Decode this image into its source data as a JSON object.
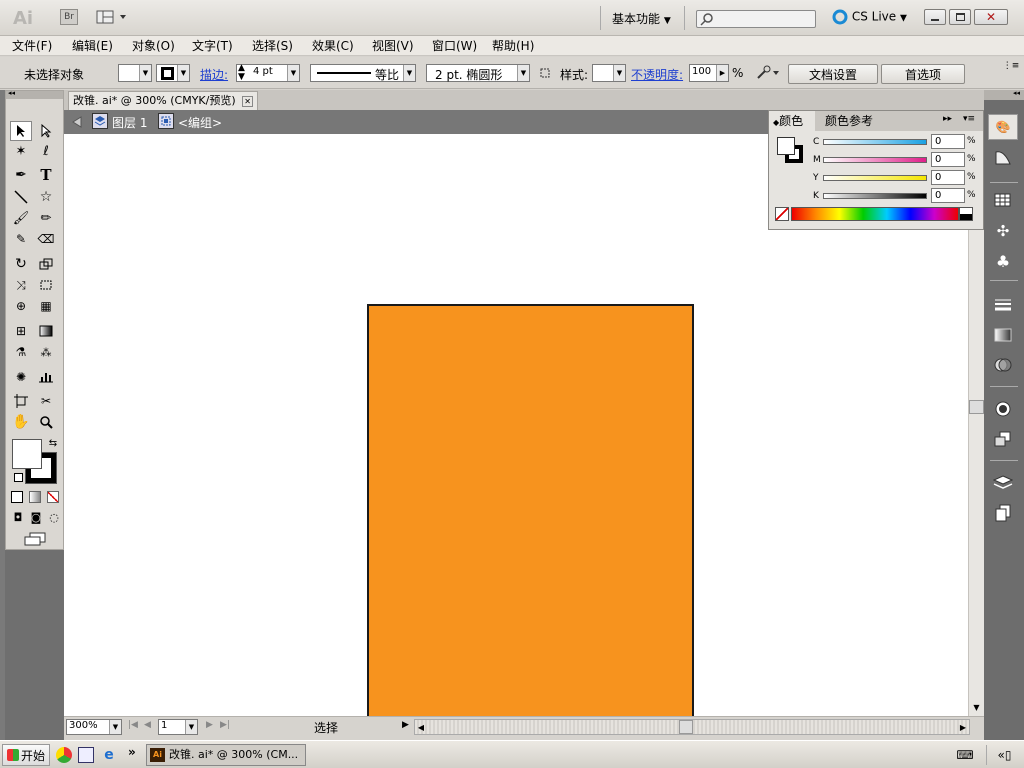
{
  "app": {
    "logo": "Ai",
    "br": "Br",
    "workspace": "基本功能",
    "cslive": "CS Live"
  },
  "menu": [
    "文件(F)",
    "编辑(E)",
    "对象(O)",
    "文字(T)",
    "选择(S)",
    "效果(C)",
    "视图(V)",
    "窗口(W)",
    "帮助(H)"
  ],
  "control": {
    "selection": "未选择对象",
    "stroke_label": "描边:",
    "stroke_value": "4 pt",
    "stroke_profile": "等比",
    "brush": "2 pt. 椭圆形",
    "style_label": "样式:",
    "opacity_label": "不透明度:",
    "opacity_value": "100",
    "percent": "%",
    "doc_setup": "文档设置",
    "prefs": "首选项"
  },
  "document": {
    "tab": "改锥. ai* @ 300% (CMYK/预览)",
    "layer": "图层 1",
    "group": "<编组>"
  },
  "shape": {
    "fill": "#f7931e",
    "stroke": "#1a1a1a"
  },
  "color_panel": {
    "tab1": "颜色",
    "tab2": "颜色参考",
    "channels": [
      {
        "label": "C",
        "value": "0"
      },
      {
        "label": "M",
        "value": "0"
      },
      {
        "label": "Y",
        "value": "0"
      },
      {
        "label": "K",
        "value": "0"
      }
    ],
    "percent": "%"
  },
  "status": {
    "zoom": "300%",
    "page": "1",
    "mode": "选择"
  },
  "taskbar": {
    "start": "开始",
    "task": "改锥. ai* @ 300% (CM...",
    "more": "»"
  }
}
